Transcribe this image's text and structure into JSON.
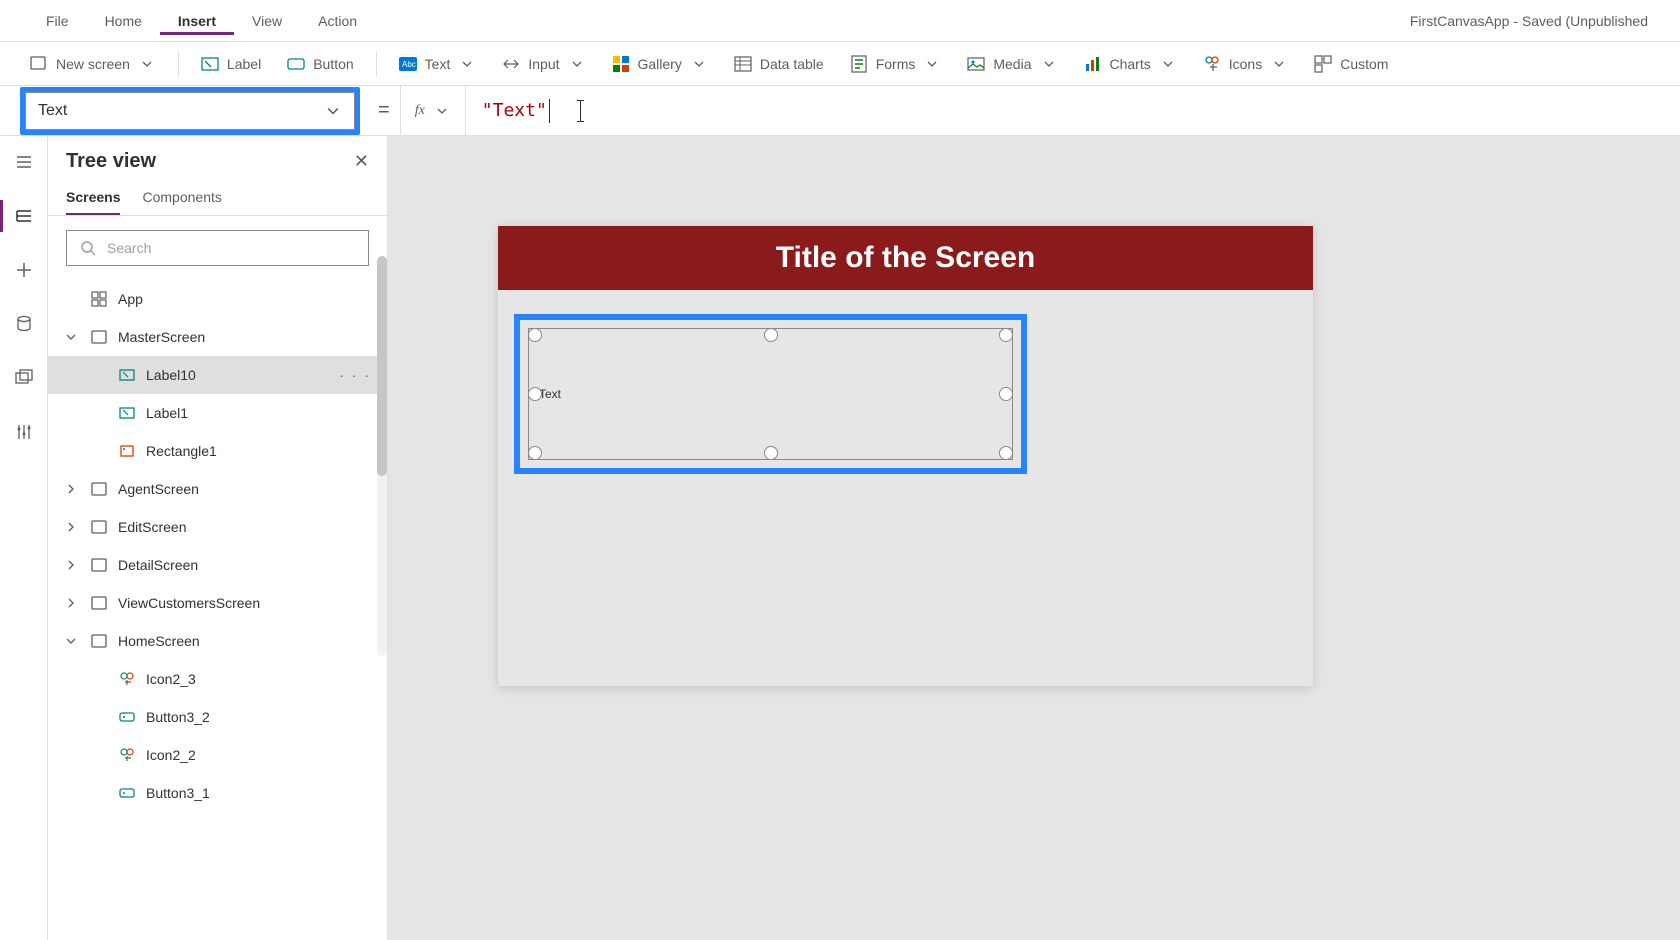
{
  "app_title": "FirstCanvasApp - Saved (Unpublished",
  "menu": {
    "file": "File",
    "home": "Home",
    "insert": "Insert",
    "view": "View",
    "action": "Action",
    "active": "Insert"
  },
  "toolbar": {
    "new_screen": "New screen",
    "label": "Label",
    "button": "Button",
    "text": "Text",
    "input": "Input",
    "gallery": "Gallery",
    "data_table": "Data table",
    "forms": "Forms",
    "media": "Media",
    "charts": "Charts",
    "icons": "Icons",
    "custom": "Custom"
  },
  "formula": {
    "property": "Text",
    "equals": "=",
    "fx": "fx",
    "value": "\"Text\""
  },
  "tree": {
    "title": "Tree view",
    "tabs": {
      "screens": "Screens",
      "components": "Components",
      "active": "Screens"
    },
    "search_placeholder": "Search",
    "nodes": [
      {
        "depth": 0,
        "exp": "",
        "icon": "app",
        "label": "App"
      },
      {
        "depth": 0,
        "exp": "down",
        "icon": "screen",
        "label": "MasterScreen"
      },
      {
        "depth": 1,
        "exp": "",
        "icon": "label",
        "label": "Label10",
        "selected": true,
        "more": "· · ·"
      },
      {
        "depth": 1,
        "exp": "",
        "icon": "label",
        "label": "Label1"
      },
      {
        "depth": 1,
        "exp": "",
        "icon": "rect",
        "label": "Rectangle1"
      },
      {
        "depth": 0,
        "exp": "right",
        "icon": "screen",
        "label": "AgentScreen"
      },
      {
        "depth": 0,
        "exp": "right",
        "icon": "screen",
        "label": "EditScreen"
      },
      {
        "depth": 0,
        "exp": "right",
        "icon": "screen",
        "label": "DetailScreen"
      },
      {
        "depth": 0,
        "exp": "right",
        "icon": "screen",
        "label": "ViewCustomersScreen"
      },
      {
        "depth": 0,
        "exp": "down",
        "icon": "screen",
        "label": "HomeScreen"
      },
      {
        "depth": 1,
        "exp": "",
        "icon": "iconctl",
        "label": "Icon2_3"
      },
      {
        "depth": 1,
        "exp": "",
        "icon": "buttonctl",
        "label": "Button3_2"
      },
      {
        "depth": 1,
        "exp": "",
        "icon": "iconctl",
        "label": "Icon2_2"
      },
      {
        "depth": 1,
        "exp": "",
        "icon": "buttonctl",
        "label": "Button3_1"
      }
    ]
  },
  "canvas": {
    "screen_title": "Title of the Screen",
    "selected_label_text": "Text",
    "colors": {
      "title_bar": "#8b1a1a",
      "highlight": "#2684ff"
    }
  }
}
